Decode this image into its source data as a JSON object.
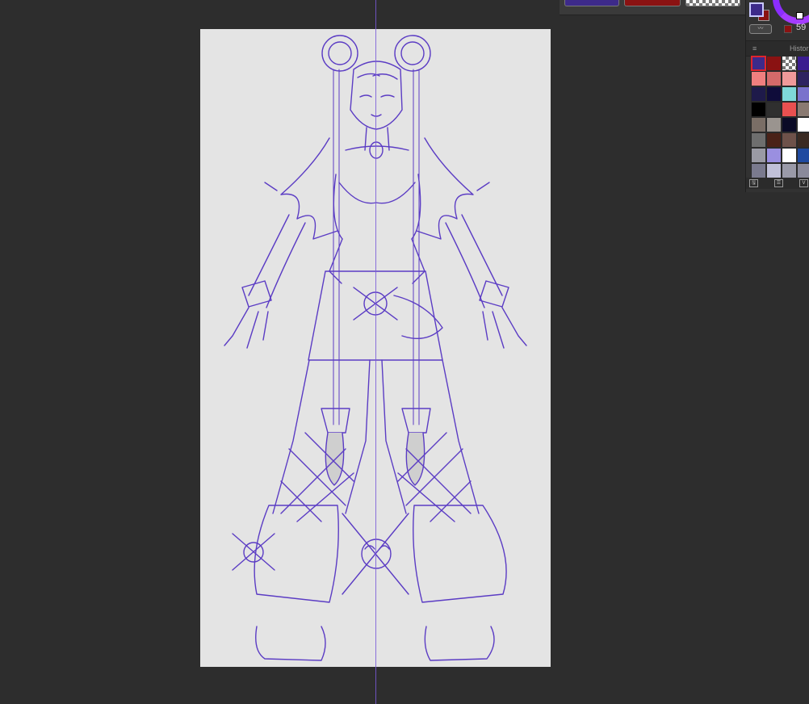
{
  "canvas": {
    "background": "#e4e4e4",
    "line_color": "#5b3cc4",
    "guide_color": "#7a5bd8"
  },
  "top_swatches": [
    {
      "name": "purple",
      "color": "#3d2a8a"
    },
    {
      "name": "red",
      "color": "#8a1212"
    },
    {
      "name": "transparent",
      "color": "checker"
    }
  ],
  "color_panel": {
    "foreground_color": "#3d2a8a",
    "background_color": "#8a1212",
    "mode_toggle_label": "〰",
    "opacity_value": "59",
    "tab_label": "Histor",
    "menu_icon": "≡",
    "swatches": [
      "#3d2a8a",
      "#8a1212",
      "checker",
      "#3a1c8f",
      "#f07f7f",
      "#d46a6a",
      "#f09a9a",
      "#2e2360",
      "#1e1a4a",
      "#0f0c3a",
      "#7fd9d9",
      "#7a72cc",
      "#000000",
      "#2f2f2f",
      "#e85050",
      "#8a7a72",
      "#7a6e66",
      "#9a948f",
      "#0b0b26",
      "#ffffff",
      "#6e6e6e",
      "#4a2218",
      "#6e524a",
      "#3a2a22",
      "#9a9aa4",
      "#9a8fe0",
      "#ffffff",
      "#1f4aa0",
      "#7a7a8e",
      "#c0c0d8",
      "#9a9aa8",
      "#8a8a9a"
    ],
    "footer_icons": [
      "save-icon",
      "load-icon",
      "menu-icon"
    ],
    "footer_labels": [
      "🖫",
      "☰",
      "V"
    ]
  }
}
